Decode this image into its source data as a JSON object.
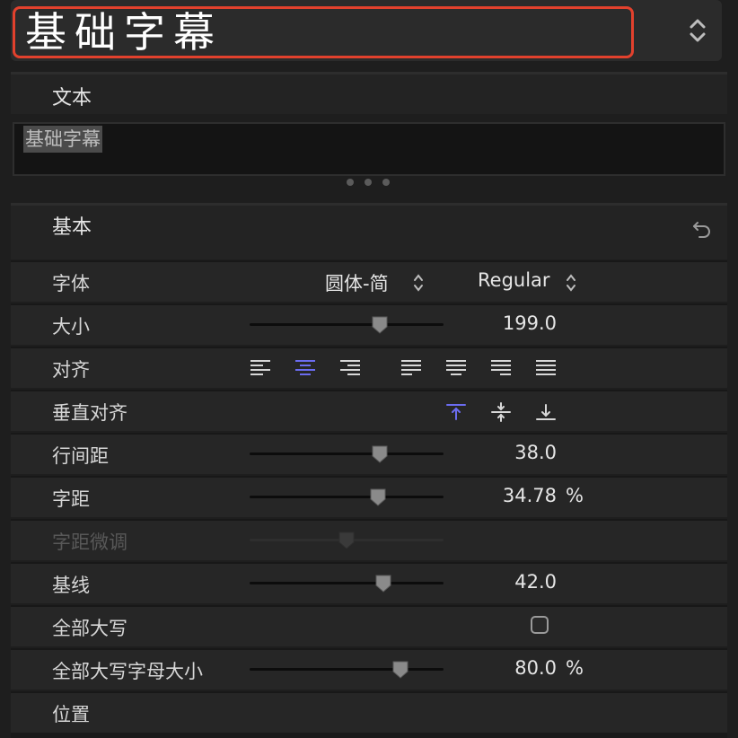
{
  "title": "基础字幕",
  "text_section": {
    "label": "文本",
    "content": "基础字幕"
  },
  "basic_section": {
    "label": "基本"
  },
  "rows": {
    "font": {
      "label": "字体",
      "family": "圆体-简",
      "style": "Regular"
    },
    "size": {
      "label": "大小",
      "value": "199.0",
      "slider_fraction": 0.67
    },
    "alignment": {
      "label": "对齐",
      "selected": "center"
    },
    "vertical_alignment": {
      "label": "垂直对齐",
      "selected": "top"
    },
    "line_spacing": {
      "label": "行间距",
      "value": "38.0",
      "slider_fraction": 0.67
    },
    "tracking": {
      "label": "字距",
      "value": "34.78",
      "unit": "%",
      "slider_fraction": 0.66
    },
    "kerning": {
      "label": "字距微调",
      "disabled": true,
      "slider_fraction": 0.5
    },
    "baseline": {
      "label": "基线",
      "value": "42.0",
      "slider_fraction": 0.69
    },
    "all_caps": {
      "label": "全部大写",
      "checked": false
    },
    "all_caps_size": {
      "label": "全部大写字母大小",
      "value": "80.0",
      "unit": "%",
      "slider_fraction": 0.78
    },
    "position": {
      "label": "位置"
    }
  },
  "colors": {
    "highlight": "#e2412d",
    "accent": "#6b6cf0"
  }
}
